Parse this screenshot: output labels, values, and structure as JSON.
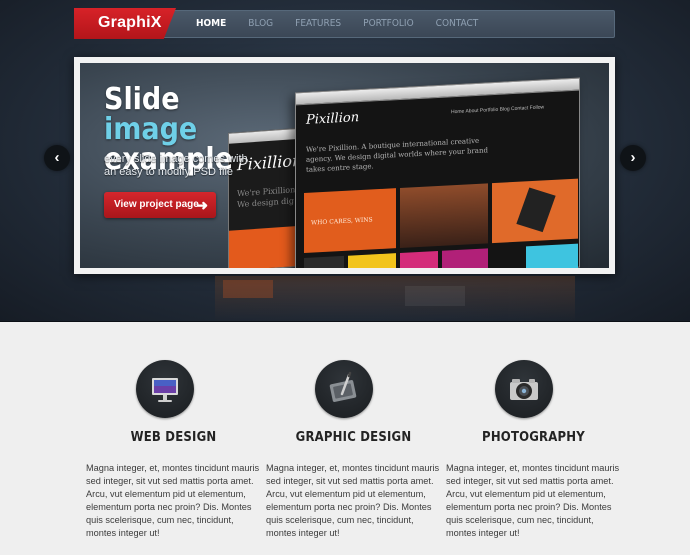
{
  "logo": {
    "text": "GraphiX"
  },
  "nav": {
    "items": [
      {
        "label": "HOME",
        "active": true
      },
      {
        "label": "BLOG",
        "active": false
      },
      {
        "label": "FEATURES",
        "active": false
      },
      {
        "label": "PORTFOLIO",
        "active": false
      },
      {
        "label": "CONTACT",
        "active": false
      }
    ]
  },
  "slider": {
    "title_line1_part1": "Slide ",
    "title_line1_part2": "image",
    "title_line2": "example",
    "description": "every slide image comes with an easy to modify PSD file",
    "button_label": "View project page",
    "prev_icon": "chevron-left-icon",
    "next_icon": "chevron-right-icon",
    "mockup": {
      "brand": "Pixillion",
      "tagline": "We're Pixillion. A boutique international creative agency. We design digital worlds where your brand takes centre stage.",
      "menu": "Home   About   Portfolio   Blog   Contact   Follow",
      "tile_text": "WHO CARES, WINS",
      "back_tagline": "We're Pixillion\nWe design dig"
    }
  },
  "services": [
    {
      "icon": "monitor-icon",
      "title": "WEB DESIGN",
      "text": "Magna integer, et, montes tincidunt mauris sed integer, sit vut sed mattis porta amet. Arcu, vut elementum pid ut elementum, elementum porta nec proin? Dis. Montes quis scelerisque, cum nec, tincidunt, montes integer ut!"
    },
    {
      "icon": "pen-tablet-icon",
      "title": "GRAPHIC DESIGN",
      "text": "Magna integer, et, montes tincidunt mauris sed integer, sit vut sed mattis porta amet. Arcu, vut elementum pid ut elementum, elementum porta nec proin? Dis. Montes quis scelerisque, cum nec, tincidunt, montes integer ut!"
    },
    {
      "icon": "camera-icon",
      "title": "PHOTOGRAPHY",
      "text": "Magna integer, et, montes tincidunt mauris sed integer, sit vut sed mattis porta amet. Arcu, vut elementum pid ut elementum, elementum porta nec proin? Dis. Montes quis scelerisque, cum nec, tincidunt, montes integer ut!"
    }
  ],
  "colors": {
    "brand_red": "#c81b21",
    "accent_cyan": "#6fd0e8",
    "hero_dark": "#26313f",
    "page_bg": "#efefef"
  }
}
